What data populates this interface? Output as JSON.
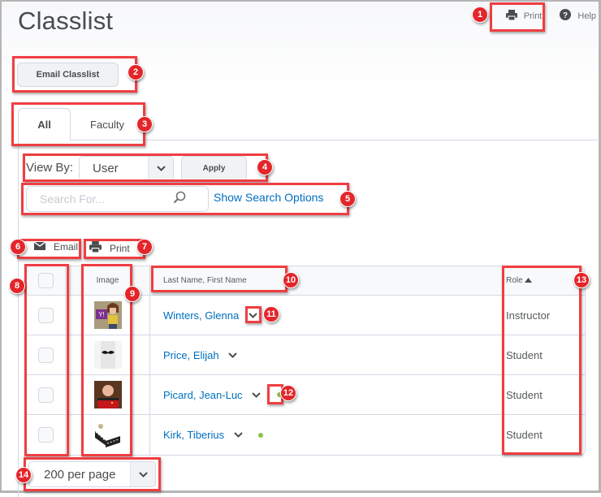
{
  "page": {
    "title": "Classlist"
  },
  "top_links": {
    "print": "Print",
    "help": "Help"
  },
  "actions": {
    "email_classlist": "Email Classlist"
  },
  "tabs": [
    {
      "label": "All",
      "active": true
    },
    {
      "label": "Faculty",
      "active": false
    }
  ],
  "view_by": {
    "label": "View By:",
    "selected": "User",
    "apply": "Apply"
  },
  "search": {
    "placeholder": "Search For...",
    "value": "",
    "options_link": "Show Search Options"
  },
  "toolbar": {
    "email": "Email",
    "print": "Print"
  },
  "table": {
    "headers": {
      "select": "",
      "image": "Image",
      "name": "Last Name, First Name",
      "role": "Role",
      "role_sort": "ascending"
    },
    "rows": [
      {
        "name": "Winters, Glenna",
        "role": "Instructor",
        "online": false,
        "avatar": "cartoon-woman-laptop"
      },
      {
        "name": "Price, Elijah",
        "role": "Student",
        "online": false,
        "avatar": "mustache-glass"
      },
      {
        "name": "Picard, Jean-Luc",
        "role": "Student",
        "online": true,
        "avatar": "man-red-uniform"
      },
      {
        "name": "Kirk, Tiberius",
        "role": "Student",
        "online": true,
        "avatar": "sneakers"
      }
    ]
  },
  "pagination": {
    "per_page": "200 per page"
  },
  "callouts": [
    "1",
    "2",
    "3",
    "4",
    "5",
    "6",
    "7",
    "8",
    "9",
    "10",
    "11",
    "12",
    "13",
    "14"
  ],
  "colors": {
    "accent_link": "#006fbf",
    "callout_red": "#ef3e42",
    "online_green": "#8bc34a"
  }
}
